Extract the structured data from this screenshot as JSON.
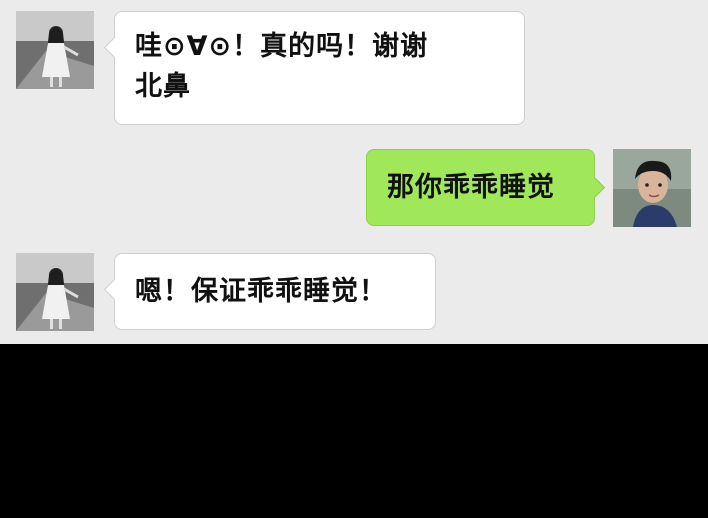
{
  "messages": [
    {
      "sender": "them",
      "lines": [
        "哇⊙∀⊙！真的吗！谢谢",
        "北鼻"
      ]
    },
    {
      "sender": "me",
      "text": "那你乖乖睡觉"
    },
    {
      "sender": "them",
      "text": "嗯！保证乖乖睡觉！"
    }
  ],
  "colors": {
    "background": "#ebebeb",
    "incoming_bubble": "#ffffff",
    "outgoing_bubble": "#a0e75a",
    "below_area": "#000000"
  }
}
